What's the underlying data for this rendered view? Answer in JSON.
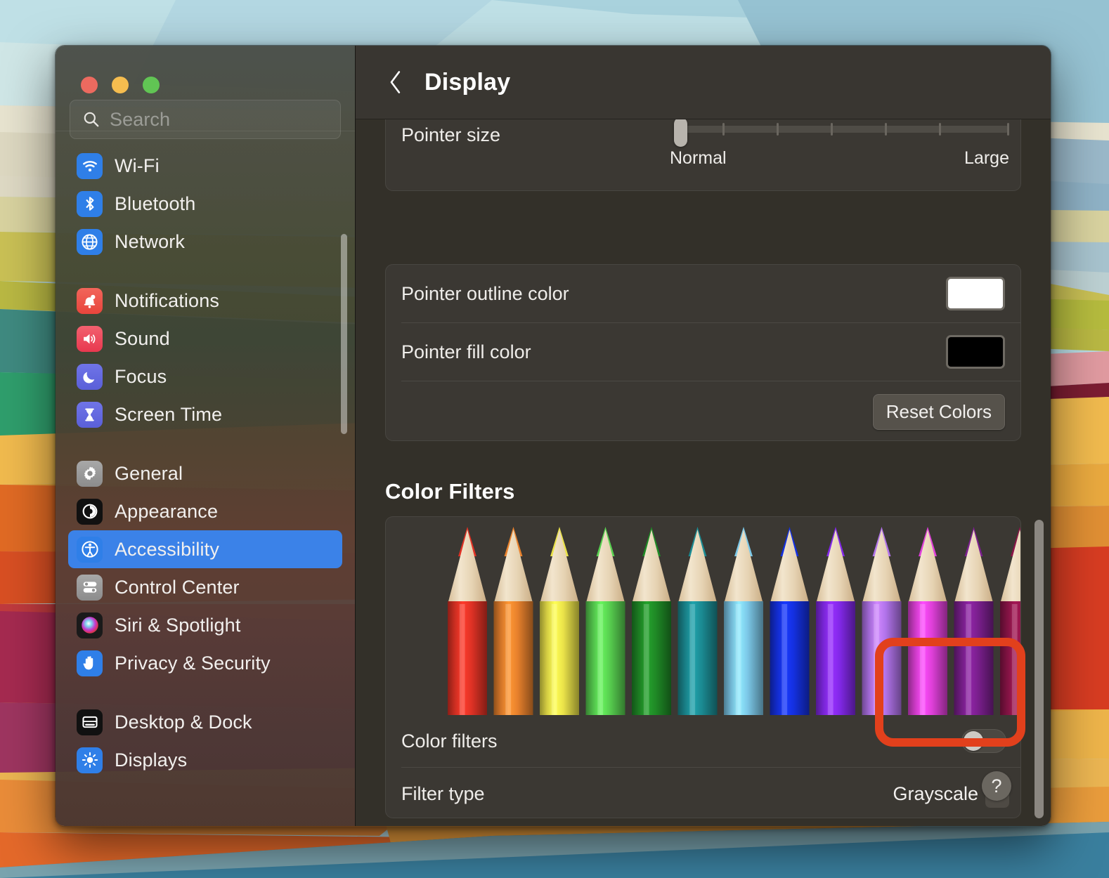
{
  "window": {
    "traffic_lights": [
      {
        "name": "close",
        "color": "#ec6a5f"
      },
      {
        "name": "minimize",
        "color": "#f5bd4f"
      },
      {
        "name": "zoom",
        "color": "#61c554"
      }
    ]
  },
  "sidebar": {
    "search": {
      "placeholder": "Search",
      "value": "",
      "icon": "search-icon"
    },
    "groups": [
      {
        "items": [
          {
            "label": "Wi-Fi",
            "icon": "wifi-icon",
            "selected": false
          },
          {
            "label": "Bluetooth",
            "icon": "bluetooth-icon",
            "selected": false
          },
          {
            "label": "Network",
            "icon": "globe-icon",
            "selected": false
          }
        ]
      },
      {
        "items": [
          {
            "label": "Notifications",
            "icon": "bell-icon",
            "selected": false
          },
          {
            "label": "Sound",
            "icon": "speaker-icon",
            "selected": false
          },
          {
            "label": "Focus",
            "icon": "moon-icon",
            "selected": false
          },
          {
            "label": "Screen Time",
            "icon": "hourglass-icon",
            "selected": false
          }
        ]
      },
      {
        "items": [
          {
            "label": "General",
            "icon": "gear-icon",
            "selected": false
          },
          {
            "label": "Appearance",
            "icon": "appearance-icon",
            "selected": false
          },
          {
            "label": "Accessibility",
            "icon": "accessibility-icon",
            "selected": true
          },
          {
            "label": "Control Center",
            "icon": "control-center-icon",
            "selected": false
          },
          {
            "label": "Siri & Spotlight",
            "icon": "siri-icon",
            "selected": false
          },
          {
            "label": "Privacy & Security",
            "icon": "hand-icon",
            "selected": false
          }
        ]
      },
      {
        "items": [
          {
            "label": "Desktop & Dock",
            "icon": "desktop-dock-icon",
            "selected": false
          },
          {
            "label": "Displays",
            "icon": "brightness-icon",
            "selected": false
          }
        ]
      }
    ]
  },
  "detail": {
    "title": "Display",
    "back_icon": "chevron-left-icon",
    "pointer_size": {
      "label": "Pointer size",
      "min_label": "Normal",
      "max_label": "Large",
      "value": 0,
      "tick_count": 6
    },
    "pointer_colors": {
      "outline_label": "Pointer outline color",
      "outline_color": "#ffffff",
      "fill_label": "Pointer fill color",
      "fill_color": "#000000",
      "reset_label": "Reset Colors"
    },
    "color_filters": {
      "section_title": "Color Filters",
      "toggle_label": "Color filters",
      "toggle_on": false,
      "filter_type_label": "Filter type",
      "filter_type_value": "Grayscale",
      "stepper_icon": "chevron-up-down-icon",
      "preview_image_name": "colored-pencils-preview",
      "preview_pencil_colors": [
        "#e03225",
        "#e8812c",
        "#eae249",
        "#58d050",
        "#1f8a26",
        "#1b8b93",
        "#7cc8e8",
        "#1430e0",
        "#8228e8",
        "#b173ea",
        "#e040da",
        "#7b1f8e",
        "#8c1448",
        "#9a5a1c"
      ]
    },
    "help_button_label": "?"
  },
  "annotation": {
    "name": "highlight-box",
    "color": "#e2401c"
  },
  "wallpaper": {
    "name": "macos-layered-bands-wallpaper"
  }
}
